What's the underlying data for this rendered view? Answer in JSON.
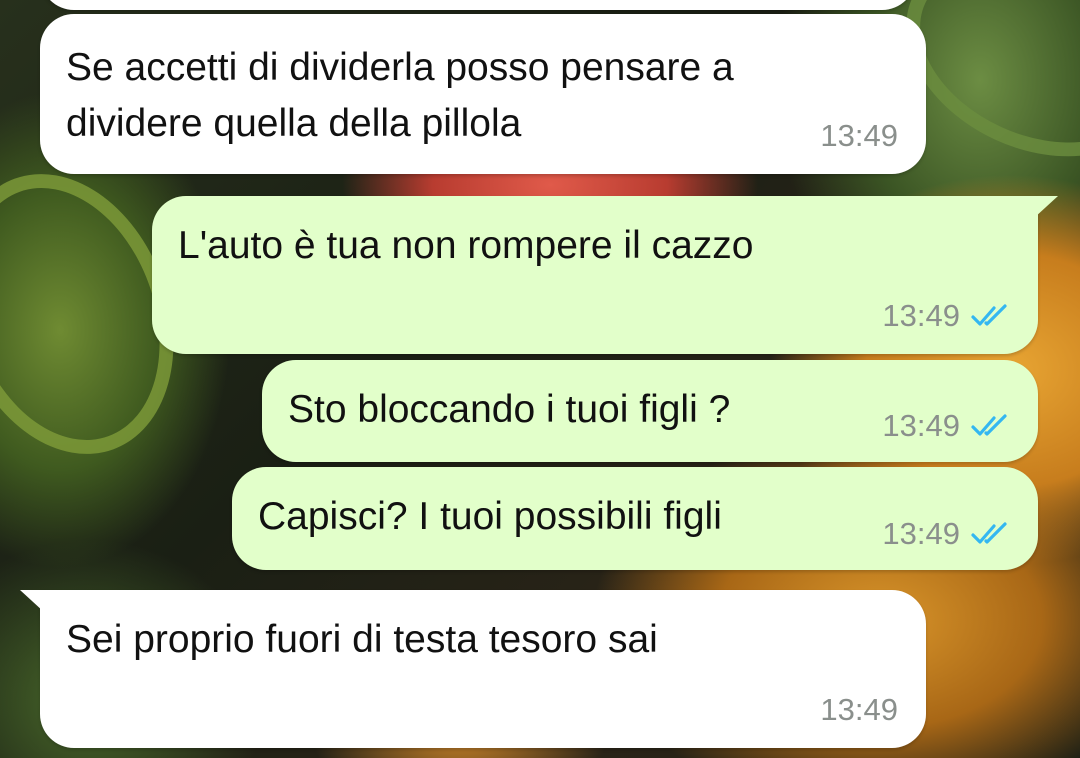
{
  "messages": [
    {
      "direction": "incoming",
      "lines": [
        "Se accetti di dividerla posso pensare a",
        "dividere quella della pillola"
      ],
      "time": "13:49",
      "ticks": null
    },
    {
      "direction": "outgoing",
      "lines": [
        "L'auto è tua non rompere il cazzo"
      ],
      "time": "13:49",
      "ticks": "double-check-read-icon"
    },
    {
      "direction": "outgoing",
      "lines": [
        "Sto bloccando i tuoi figli ?"
      ],
      "time": "13:49",
      "ticks": "double-check-read-icon"
    },
    {
      "direction": "outgoing",
      "lines": [
        "Capisci? I tuoi possibili figli"
      ],
      "time": "13:49",
      "ticks": "double-check-read-icon"
    },
    {
      "direction": "incoming",
      "lines": [
        "Sei proprio fuori di testa tesoro sai"
      ],
      "time": "13:49",
      "ticks": null
    }
  ],
  "colors": {
    "incoming_bubble": "#ffffff",
    "outgoing_bubble": "#e2ffca",
    "read_tick": "#34b7f1",
    "timestamp": "#8a8f8c"
  }
}
